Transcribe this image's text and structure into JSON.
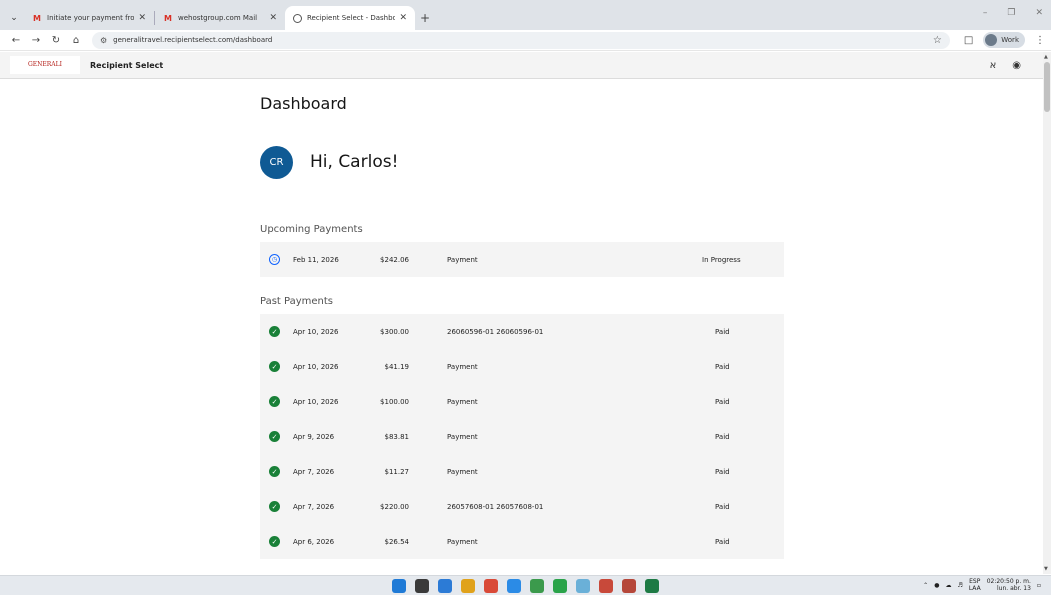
{
  "browser": {
    "tabs": [
      {
        "title": "Initiate your payment from Gen",
        "favicon": "gmail-icon",
        "active": false
      },
      {
        "title": "wehostgroup.com Mail",
        "favicon": "gmail-icon",
        "active": false
      },
      {
        "title": "Recipient Select - Dashboard",
        "favicon": "recipient-select-icon",
        "active": true
      }
    ],
    "url": "generalitravel.recipientselect.com/dashboard",
    "profile_label": "Work"
  },
  "header": {
    "logo_text": "GENERALI",
    "brand": "Recipient Select"
  },
  "dashboard": {
    "title": "Dashboard",
    "avatar_initials": "CR",
    "greeting": "Hi, Carlos!",
    "avatar_color": "#0f5a94"
  },
  "upcoming": {
    "title": "Upcoming Payments",
    "rows": [
      {
        "date": "Feb 11, 2026",
        "amount": "$242.06",
        "description": "Payment",
        "status": "In Progress",
        "icon": "clock-icon"
      }
    ]
  },
  "past": {
    "title": "Past Payments",
    "rows": [
      {
        "date": "Apr 10, 2026",
        "amount": "$300.00",
        "description": "26060596-01 26060596-01",
        "status": "Paid",
        "icon": "check-circle-icon"
      },
      {
        "date": "Apr 10, 2026",
        "amount": "$41.19",
        "description": "Payment",
        "status": "Paid",
        "icon": "check-circle-icon"
      },
      {
        "date": "Apr 10, 2026",
        "amount": "$100.00",
        "description": "Payment",
        "status": "Paid",
        "icon": "check-circle-icon"
      },
      {
        "date": "Apr 9, 2026",
        "amount": "$83.81",
        "description": "Payment",
        "status": "Paid",
        "icon": "check-circle-icon"
      },
      {
        "date": "Apr 7, 2026",
        "amount": "$11.27",
        "description": "Payment",
        "status": "Paid",
        "icon": "check-circle-icon"
      },
      {
        "date": "Apr 7, 2026",
        "amount": "$220.00",
        "description": "26057608-01 26057608-01",
        "status": "Paid",
        "icon": "check-circle-icon"
      },
      {
        "date": "Apr 6, 2026",
        "amount": "$26.54",
        "description": "Payment",
        "status": "Paid",
        "icon": "check-circle-icon"
      }
    ]
  },
  "taskbar": {
    "lang_top": "ESP",
    "lang_bottom": "LAA",
    "time": "02:20:50 p. m.",
    "date": "lun. abr. 13",
    "apps": [
      {
        "name": "windows-start-icon",
        "color": "#1f7ad6"
      },
      {
        "name": "terminal-icon",
        "color": "#3a3a3a"
      },
      {
        "name": "file-explorer-icon",
        "color": "#2c7bd6"
      },
      {
        "name": "photos-icon",
        "color": "#e0a21b"
      },
      {
        "name": "chrome-icon",
        "color": "#d94a38"
      },
      {
        "name": "app-blue-icon",
        "color": "#2b8be6"
      },
      {
        "name": "chrome-profile-icon",
        "color": "#3b9a4c"
      },
      {
        "name": "whatsapp-icon",
        "color": "#2aa34a"
      },
      {
        "name": "notes-icon",
        "color": "#6ab0d8"
      },
      {
        "name": "chrome-profile-2-icon",
        "color": "#c8493a"
      },
      {
        "name": "chrome-profile-3-icon",
        "color": "#b5473a"
      },
      {
        "name": "excel-icon",
        "color": "#1d7a44"
      }
    ]
  }
}
